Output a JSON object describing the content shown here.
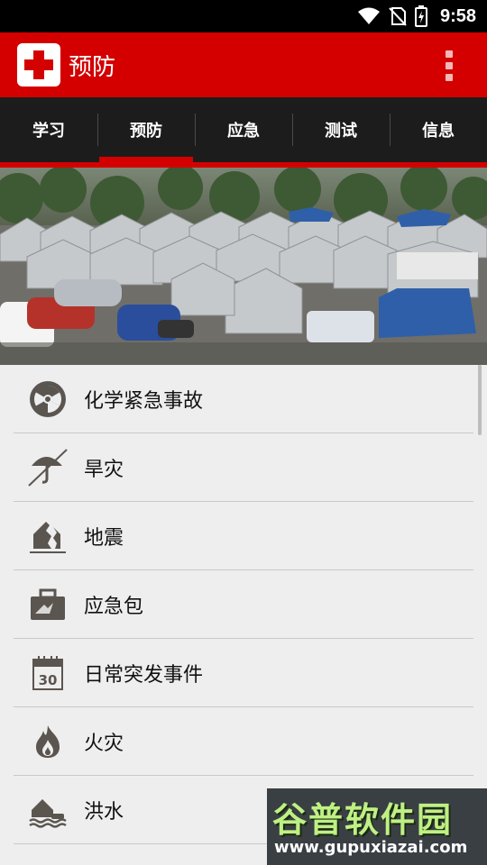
{
  "status_bar": {
    "time": "9:58"
  },
  "app_bar": {
    "title": "预防"
  },
  "tabs": [
    {
      "label": "学习"
    },
    {
      "label": "预防"
    },
    {
      "label": "应急"
    },
    {
      "label": "测试"
    },
    {
      "label": "信息"
    }
  ],
  "active_tab": "预防",
  "list": {
    "items": [
      {
        "label": "化学紧急事故",
        "icon": "radiation-icon"
      },
      {
        "label": "旱灾",
        "icon": "drought-umbrella-icon"
      },
      {
        "label": "地震",
        "icon": "earthquake-house-icon"
      },
      {
        "label": "应急包",
        "icon": "emergency-kit-icon"
      },
      {
        "label": "日常突发事件",
        "icon": "calendar-30-icon"
      },
      {
        "label": "火灾",
        "icon": "fire-icon"
      },
      {
        "label": "洪水",
        "icon": "flood-house-icon"
      }
    ]
  },
  "watermark": {
    "title": "谷普软件园",
    "url": "www.gupuxiazai.com"
  },
  "colors": {
    "primary": "#d40000",
    "tab_bar": "#1c1c1c",
    "icon": "#5b5550"
  }
}
